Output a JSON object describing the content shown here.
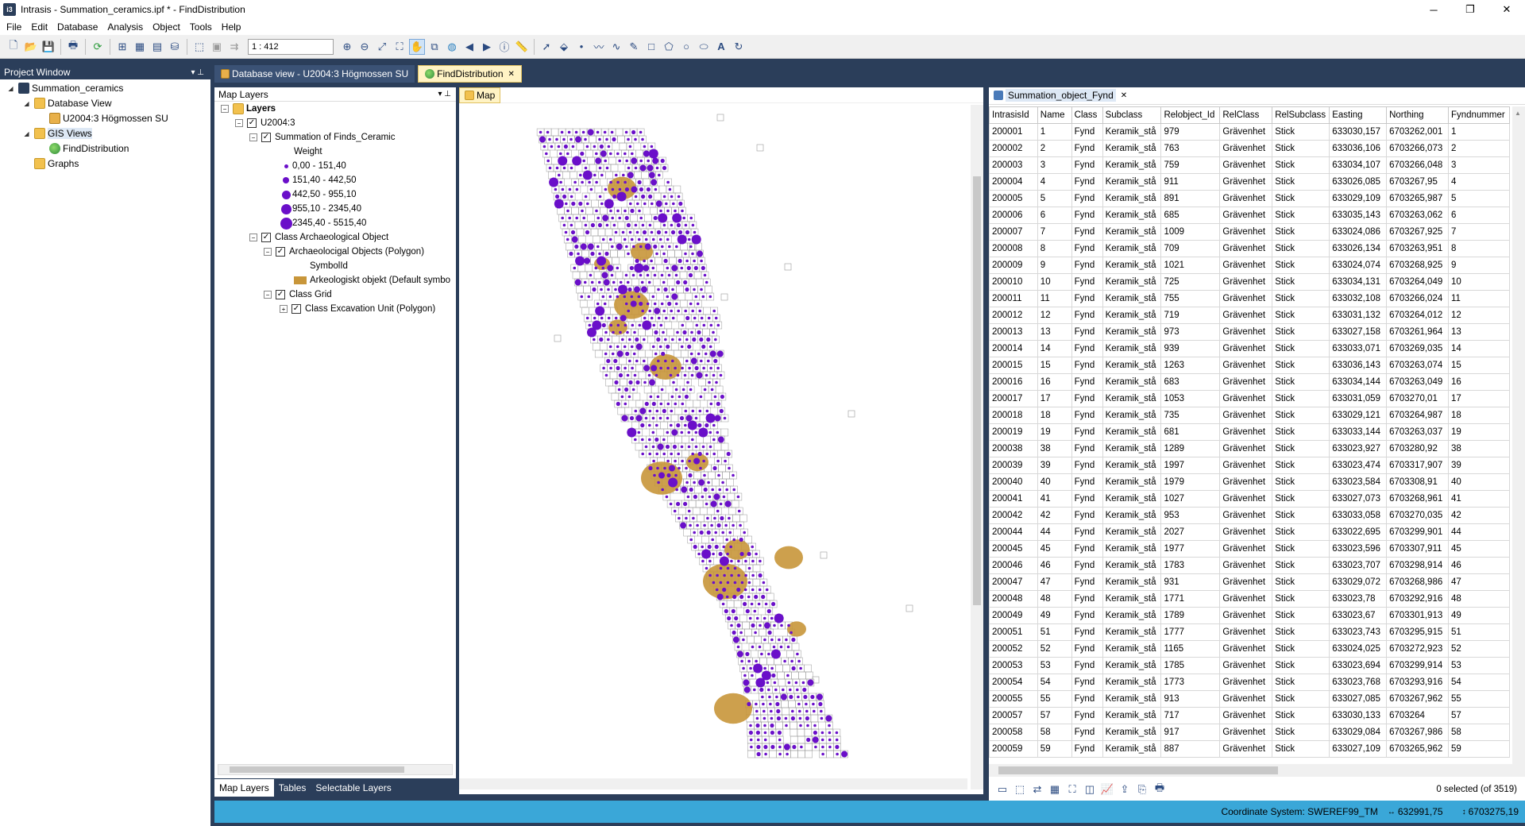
{
  "window": {
    "title": "Intrasis - Summation_ceramics.ipf * - FindDistribution",
    "app_icon_text": "i3",
    "minimize": "─",
    "maximize": "❐",
    "close": "✕"
  },
  "menu": [
    "File",
    "Edit",
    "Database",
    "Analysis",
    "Object",
    "Tools",
    "Help"
  ],
  "toolbar": {
    "scale_value": "1 : 412"
  },
  "project_window": {
    "title": "Project Window",
    "tree": [
      {
        "label": "Summation_ceramics",
        "level": 0,
        "icon": "app-icon"
      },
      {
        "label": "Database View",
        "level": 1,
        "icon": "folder-icon"
      },
      {
        "label": "U2004:3 Högmossen SU",
        "level": 2,
        "icon": "database-icon"
      },
      {
        "label": "GIS Views",
        "level": 1,
        "icon": "folder-icon"
      },
      {
        "label": "FindDistribution",
        "level": 2,
        "icon": "globe-icon"
      },
      {
        "label": "Graphs",
        "level": 1,
        "icon": "folder-icon"
      }
    ]
  },
  "doc_tabs": [
    {
      "label": "Database view - U2004:3 Högmossen SU",
      "active": false
    },
    {
      "label": "FindDistribution",
      "active": true,
      "close": "✕"
    }
  ],
  "map_layers": {
    "title": "Map Layers",
    "rows": [
      {
        "label": "Layers",
        "type": "root"
      },
      {
        "label": "U2004:3",
        "type": "group"
      },
      {
        "label": "Summation of Finds_Ceramic",
        "type": "layer"
      },
      {
        "label": "Weight",
        "type": "heading"
      },
      {
        "label": "0,00 - 151,40",
        "type": "legend"
      },
      {
        "label": "151,40 - 442,50",
        "type": "legend"
      },
      {
        "label": "442,50 - 955,10",
        "type": "legend"
      },
      {
        "label": "955,10 - 2345,40",
        "type": "legend"
      },
      {
        "label": "2345,40 - 5515,40",
        "type": "legend"
      },
      {
        "label": "Class Archaeological Object",
        "type": "layer"
      },
      {
        "label": "Archaeolocigal Objects (Polygon)",
        "type": "sublayer"
      },
      {
        "label": "SymbolId",
        "type": "heading"
      },
      {
        "label": "Arkeologiskt objekt (Default symbo",
        "type": "legend-poly"
      },
      {
        "label": "Class Grid",
        "type": "sublayer"
      },
      {
        "label": "Class Excavation Unit (Polygon)",
        "type": "sublayer2"
      }
    ],
    "bottom_tabs": [
      "Map Layers",
      "Tables",
      "Selectable Layers"
    ]
  },
  "map": {
    "tab_label": "Map"
  },
  "table": {
    "tab_label": "Summation_object_Fynd",
    "tab_close": "✕",
    "columns": [
      "IntrasisId",
      "Name",
      "Class",
      "Subclass",
      "Relobject_Id",
      "RelClass",
      "RelSubclass",
      "Easting",
      "Northing",
      "Fyndnummer"
    ],
    "rows": [
      [
        "200001",
        "1",
        "Fynd",
        "Keramik_stå",
        "979",
        "Grävenhet",
        "Stick",
        "633030,157",
        "6703262,001",
        "1"
      ],
      [
        "200002",
        "2",
        "Fynd",
        "Keramik_stå",
        "763",
        "Grävenhet",
        "Stick",
        "633036,106",
        "6703266,073",
        "2"
      ],
      [
        "200003",
        "3",
        "Fynd",
        "Keramik_stå",
        "759",
        "Grävenhet",
        "Stick",
        "633034,107",
        "6703266,048",
        "3"
      ],
      [
        "200004",
        "4",
        "Fynd",
        "Keramik_stå",
        "911",
        "Grävenhet",
        "Stick",
        "633026,085",
        "6703267,95",
        "4"
      ],
      [
        "200005",
        "5",
        "Fynd",
        "Keramik_stå",
        "891",
        "Grävenhet",
        "Stick",
        "633029,109",
        "6703265,987",
        "5"
      ],
      [
        "200006",
        "6",
        "Fynd",
        "Keramik_stå",
        "685",
        "Grävenhet",
        "Stick",
        "633035,143",
        "6703263,062",
        "6"
      ],
      [
        "200007",
        "7",
        "Fynd",
        "Keramik_stå",
        "1009",
        "Grävenhet",
        "Stick",
        "633024,086",
        "6703267,925",
        "7"
      ],
      [
        "200008",
        "8",
        "Fynd",
        "Keramik_stå",
        "709",
        "Grävenhet",
        "Stick",
        "633026,134",
        "6703263,951",
        "8"
      ],
      [
        "200009",
        "9",
        "Fynd",
        "Keramik_stå",
        "1021",
        "Grävenhet",
        "Stick",
        "633024,074",
        "6703268,925",
        "9"
      ],
      [
        "200010",
        "10",
        "Fynd",
        "Keramik_stå",
        "725",
        "Grävenhet",
        "Stick",
        "633034,131",
        "6703264,049",
        "10"
      ],
      [
        "200011",
        "11",
        "Fynd",
        "Keramik_stå",
        "755",
        "Grävenhet",
        "Stick",
        "633032,108",
        "6703266,024",
        "11"
      ],
      [
        "200012",
        "12",
        "Fynd",
        "Keramik_stå",
        "719",
        "Grävenhet",
        "Stick",
        "633031,132",
        "6703264,012",
        "12"
      ],
      [
        "200013",
        "13",
        "Fynd",
        "Keramik_stå",
        "973",
        "Grävenhet",
        "Stick",
        "633027,158",
        "6703261,964",
        "13"
      ],
      [
        "200014",
        "14",
        "Fynd",
        "Keramik_stå",
        "939",
        "Grävenhet",
        "Stick",
        "633033,071",
        "6703269,035",
        "14"
      ],
      [
        "200015",
        "15",
        "Fynd",
        "Keramik_stå",
        "1263",
        "Grävenhet",
        "Stick",
        "633036,143",
        "6703263,074",
        "15"
      ],
      [
        "200016",
        "16",
        "Fynd",
        "Keramik_stå",
        "683",
        "Grävenhet",
        "Stick",
        "633034,144",
        "6703263,049",
        "16"
      ],
      [
        "200017",
        "17",
        "Fynd",
        "Keramik_stå",
        "1053",
        "Grävenhet",
        "Stick",
        "633031,059",
        "6703270,01",
        "17"
      ],
      [
        "200018",
        "18",
        "Fynd",
        "Keramik_stå",
        "735",
        "Grävenhet",
        "Stick",
        "633029,121",
        "6703264,987",
        "18"
      ],
      [
        "200019",
        "19",
        "Fynd",
        "Keramik_stå",
        "681",
        "Grävenhet",
        "Stick",
        "633033,144",
        "6703263,037",
        "19"
      ],
      [
        "200038",
        "38",
        "Fynd",
        "Keramik_stå",
        "1289",
        "Grävenhet",
        "Stick",
        "633023,927",
        "6703280,92",
        "38"
      ],
      [
        "200039",
        "39",
        "Fynd",
        "Keramik_stå",
        "1997",
        "Grävenhet",
        "Stick",
        "633023,474",
        "6703317,907",
        "39"
      ],
      [
        "200040",
        "40",
        "Fynd",
        "Keramik_stå",
        "1979",
        "Grävenhet",
        "Stick",
        "633023,584",
        "6703308,91",
        "40"
      ],
      [
        "200041",
        "41",
        "Fynd",
        "Keramik_stå",
        "1027",
        "Grävenhet",
        "Stick",
        "633027,073",
        "6703268,961",
        "41"
      ],
      [
        "200042",
        "42",
        "Fynd",
        "Keramik_stå",
        "953",
        "Grävenhet",
        "Stick",
        "633033,058",
        "6703270,035",
        "42"
      ],
      [
        "200044",
        "44",
        "Fynd",
        "Keramik_stå",
        "2027",
        "Grävenhet",
        "Stick",
        "633022,695",
        "6703299,901",
        "44"
      ],
      [
        "200045",
        "45",
        "Fynd",
        "Keramik_stå",
        "1977",
        "Grävenhet",
        "Stick",
        "633023,596",
        "6703307,911",
        "45"
      ],
      [
        "200046",
        "46",
        "Fynd",
        "Keramik_stå",
        "1783",
        "Grävenhet",
        "Stick",
        "633023,707",
        "6703298,914",
        "46"
      ],
      [
        "200047",
        "47",
        "Fynd",
        "Keramik_stå",
        "931",
        "Grävenhet",
        "Stick",
        "633029,072",
        "6703268,986",
        "47"
      ],
      [
        "200048",
        "48",
        "Fynd",
        "Keramik_stå",
        "1771",
        "Grävenhet",
        "Stick",
        "633023,78",
        "6703292,916",
        "48"
      ],
      [
        "200049",
        "49",
        "Fynd",
        "Keramik_stå",
        "1789",
        "Grävenhet",
        "Stick",
        "633023,67",
        "6703301,913",
        "49"
      ],
      [
        "200051",
        "51",
        "Fynd",
        "Keramik_stå",
        "1777",
        "Grävenhet",
        "Stick",
        "633023,743",
        "6703295,915",
        "51"
      ],
      [
        "200052",
        "52",
        "Fynd",
        "Keramik_stå",
        "1165",
        "Grävenhet",
        "Stick",
        "633024,025",
        "6703272,923",
        "52"
      ],
      [
        "200053",
        "53",
        "Fynd",
        "Keramik_stå",
        "1785",
        "Grävenhet",
        "Stick",
        "633023,694",
        "6703299,914",
        "53"
      ],
      [
        "200054",
        "54",
        "Fynd",
        "Keramik_stå",
        "1773",
        "Grävenhet",
        "Stick",
        "633023,768",
        "6703293,916",
        "54"
      ],
      [
        "200055",
        "55",
        "Fynd",
        "Keramik_stå",
        "913",
        "Grävenhet",
        "Stick",
        "633027,085",
        "6703267,962",
        "55"
      ],
      [
        "200057",
        "57",
        "Fynd",
        "Keramik_stå",
        "717",
        "Grävenhet",
        "Stick",
        "633030,133",
        "6703264",
        "57"
      ],
      [
        "200058",
        "58",
        "Fynd",
        "Keramik_stå",
        "917",
        "Grävenhet",
        "Stick",
        "633029,084",
        "6703267,986",
        "58"
      ],
      [
        "200059",
        "59",
        "Fynd",
        "Keramik_stå",
        "887",
        "Grävenhet",
        "Stick",
        "633027,109",
        "6703265,962",
        "59"
      ]
    ],
    "selection_status": "0 selected (of 3519)"
  },
  "status": {
    "coordinate_system": "Coordinate System: SWEREF99_TM",
    "x": "632991,75",
    "y": "6703275,19"
  },
  "colors": {
    "find_points": "#6a0fc9",
    "arch_objects": "#c8963a",
    "accent": "#3aa7d8",
    "frame": "#2b3e5a"
  }
}
